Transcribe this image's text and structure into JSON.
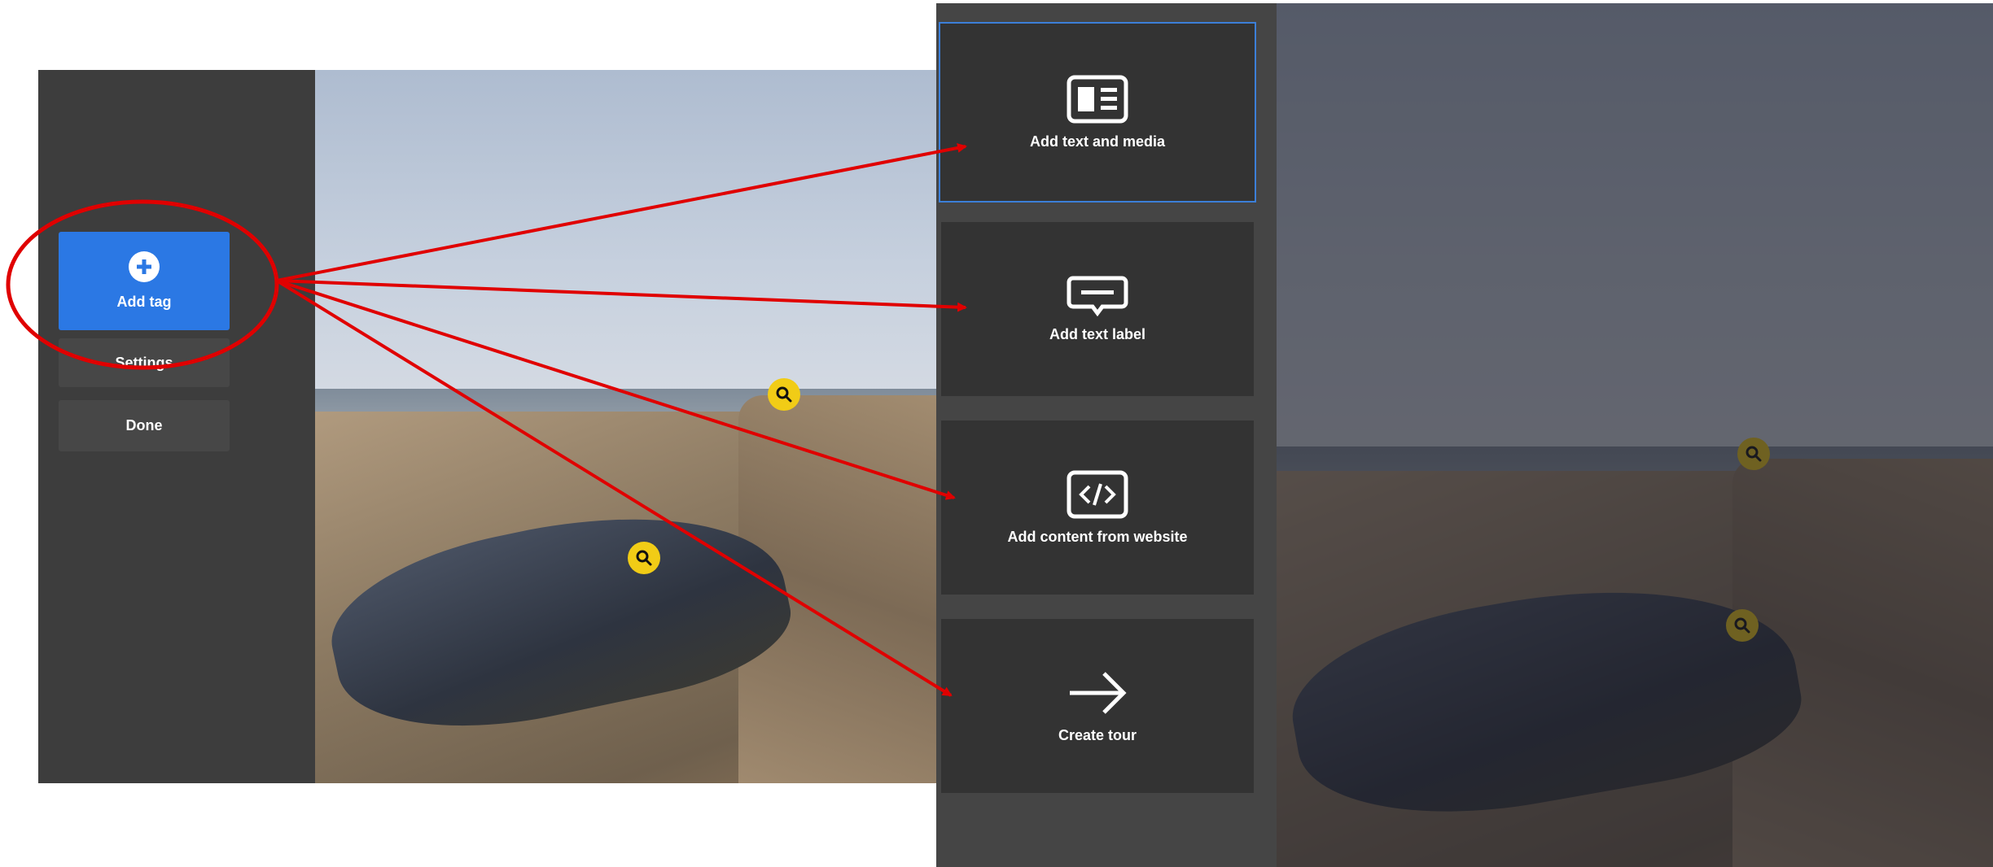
{
  "left_sidebar": {
    "add_tag_label": "Add tag",
    "settings_label": "Settings",
    "done_label": "Done"
  },
  "menu": {
    "items": [
      {
        "label": "Add text and media",
        "icon": "text-media-icon"
      },
      {
        "label": "Add text label",
        "icon": "text-label-icon"
      },
      {
        "label": "Add content from website",
        "icon": "code-icon"
      },
      {
        "label": "Create tour",
        "icon": "arrow-right-icon"
      }
    ]
  },
  "colors": {
    "accent": "#2b78e4",
    "annotation": "#e00000",
    "pin": "#f1cc16",
    "sidebar": "#3d3d3d",
    "card": "#333333"
  }
}
